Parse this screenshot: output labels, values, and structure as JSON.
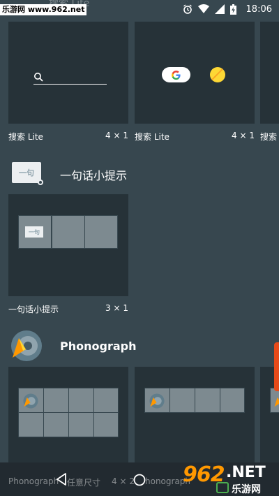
{
  "status_bar": {
    "faded_title": "搜索 Lite",
    "watermark": "乐游网 www.962.net",
    "time": "18:06"
  },
  "widgets": {
    "row1": [
      {
        "label": "搜索 Lite",
        "size": "4 × 1"
      },
      {
        "label": "搜索 Lite",
        "size": "4 × 1"
      },
      {
        "label": "搜索"
      }
    ],
    "app2": {
      "title": "一句话小提示",
      "icon_text": "一句",
      "cell_icon_text": "一句",
      "card": {
        "label": "一句话小提示",
        "size": "3 × 1"
      }
    },
    "app3": {
      "title": "Phonograph",
      "bottom_label_left": "Phonograph",
      "bottom_label_mid": "任意尺寸",
      "bottom_size": "4 × 2",
      "bottom_label_right": "honograph"
    }
  },
  "logo": {
    "digits": "962",
    "suffix": ".NET",
    "chinese": "乐游网"
  },
  "colors": {
    "background": "#37474f",
    "card": "#263238",
    "cell": "#7d8a90",
    "accent_yellow": "#fdd835",
    "accent_orange": "#ff9800"
  }
}
